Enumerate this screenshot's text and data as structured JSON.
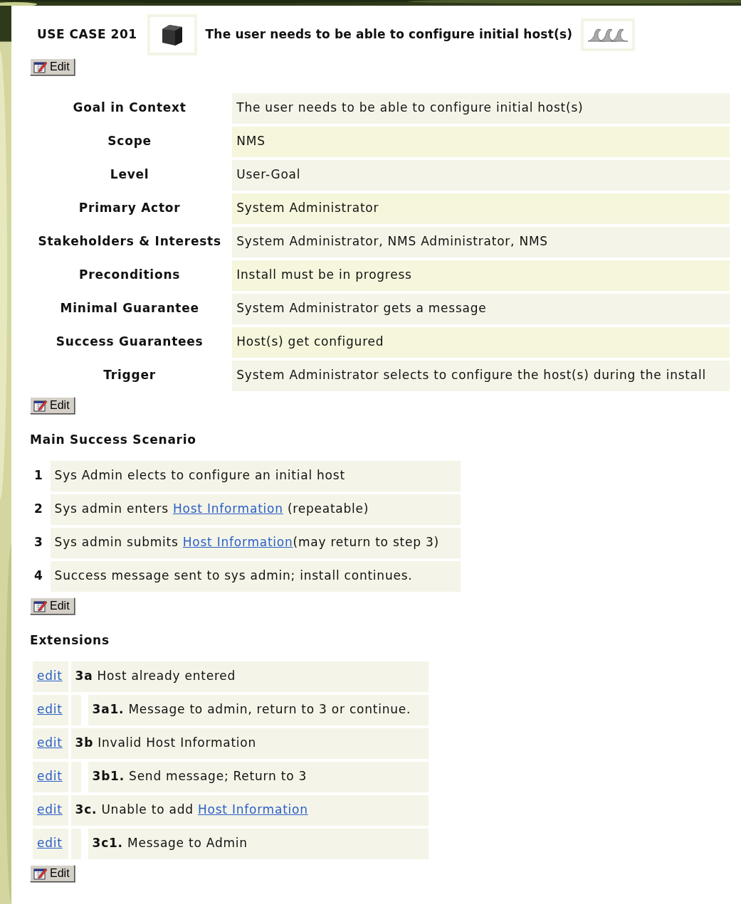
{
  "header": {
    "case_label": "USE CASE 201",
    "title": "The user needs to be able to configure initial host(s)"
  },
  "edit_buttons": [
    "Edit",
    "Edit",
    "Edit",
    "Edit"
  ],
  "fields": [
    {
      "label": "Goal in Context",
      "value": "The user needs to be able to configure initial host(s)"
    },
    {
      "label": "Scope",
      "value": "NMS"
    },
    {
      "label": "Level",
      "value": "User-Goal"
    },
    {
      "label": "Primary Actor",
      "value": "System Administrator"
    },
    {
      "label": "Stakeholders & Interests",
      "value": "System Administrator, NMS Administrator, NMS"
    },
    {
      "label": "Preconditions",
      "value": "Install must be in progress"
    },
    {
      "label": "Minimal Guarantee",
      "value": "System Administrator gets a message"
    },
    {
      "label": "Success Guarantees",
      "value": "Host(s) get configured"
    },
    {
      "label": "Trigger",
      "value": "System Administrator selects to configure the host(s) during the install"
    }
  ],
  "main_scenario": {
    "heading": "Main Success Scenario",
    "steps": [
      {
        "number": "1",
        "parts": [
          {
            "text": "Sys Admin elects to configure an initial host"
          }
        ]
      },
      {
        "number": "2",
        "parts": [
          {
            "text": "Sys admin enters "
          },
          {
            "link": "Host Information"
          },
          {
            "text": " (repeatable)"
          }
        ]
      },
      {
        "number": "3",
        "parts": [
          {
            "text": "Sys admin submits "
          },
          {
            "link": "Host Information"
          },
          {
            "text": "(may return to step 3)"
          }
        ]
      },
      {
        "number": "4",
        "parts": [
          {
            "text": "Success message sent to sys admin; install continues."
          }
        ]
      }
    ]
  },
  "extensions": {
    "heading": "Extensions",
    "items": [
      {
        "edit": "edit",
        "id": "3a",
        "parts": [
          {
            "text": "Host already entered"
          }
        ],
        "children": [
          {
            "edit": "edit",
            "id": "3a1.",
            "parts": [
              {
                "text": "Message to admin, return to 3 or continue."
              }
            ]
          }
        ]
      },
      {
        "edit": "edit",
        "id": "3b",
        "parts": [
          {
            "text": "Invalid Host Information"
          }
        ],
        "children": [
          {
            "edit": "edit",
            "id": "3b1.",
            "parts": [
              {
                "text": "Send message; Return to 3"
              }
            ]
          }
        ]
      },
      {
        "edit": "edit",
        "id": "3c.",
        "parts": [
          {
            "text": "Unable to add "
          },
          {
            "link": "Host Information"
          }
        ],
        "children": [
          {
            "edit": "edit",
            "id": "3c1.",
            "parts": [
              {
                "text": "Message to Admin"
              }
            ]
          }
        ]
      }
    ]
  }
}
